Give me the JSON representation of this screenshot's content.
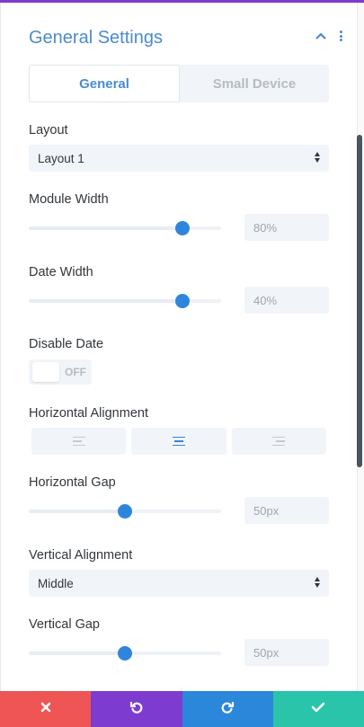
{
  "header": {
    "title": "General Settings",
    "collapse_icon": "chevron-up-icon",
    "menu_icon": "kebab-menu-icon"
  },
  "tabs": [
    {
      "label": "General",
      "active": true
    },
    {
      "label": "Small Device",
      "active": false
    }
  ],
  "fields": {
    "layout": {
      "label": "Layout",
      "value": "Layout 1"
    },
    "module_width": {
      "label": "Module Width",
      "value": "80%",
      "slider_percent": 80
    },
    "date_width": {
      "label": "Date Width",
      "value": "40%",
      "slider_percent": 80
    },
    "disable_date": {
      "label": "Disable Date",
      "toggle_text": "OFF",
      "state": false
    },
    "horizontal_alignment": {
      "label": "Horizontal Alignment",
      "options": [
        "left",
        "center",
        "right"
      ],
      "selected": "center"
    },
    "horizontal_gap": {
      "label": "Horizontal Gap",
      "value": "50px",
      "slider_percent": 50
    },
    "vertical_alignment": {
      "label": "Vertical Alignment",
      "value": "Middle"
    },
    "vertical_gap": {
      "label": "Vertical Gap",
      "value": "50px",
      "slider_percent": 50
    }
  },
  "footer": {
    "buttons": [
      {
        "name": "cancel",
        "icon": "close-icon",
        "color": "#ef5555"
      },
      {
        "name": "undo",
        "icon": "undo-icon",
        "color": "#7e3bd0"
      },
      {
        "name": "redo",
        "icon": "redo-icon",
        "color": "#2b87da"
      },
      {
        "name": "save",
        "icon": "check-icon",
        "color": "#29c4a9"
      }
    ]
  },
  "colors": {
    "accent": "#4a8ccc",
    "thumb": "#2e86dc",
    "field_bg": "#f1f5f9",
    "top_stripe": "#7e3bd0"
  }
}
